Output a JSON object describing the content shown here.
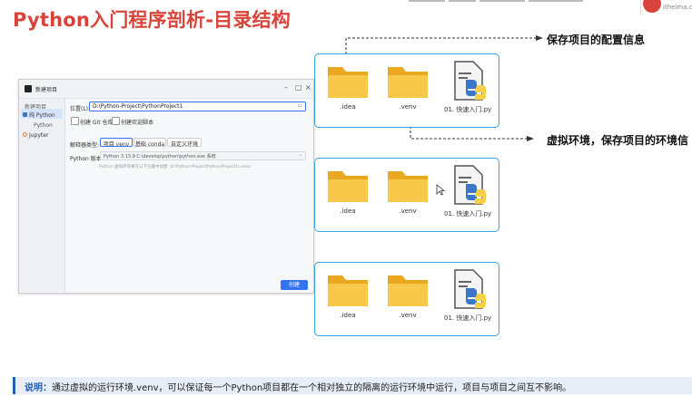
{
  "slide": {
    "title": "Python入门程序剖析-目录结构",
    "logo_text": "itheima.com",
    "note_label": "说明：",
    "note_text": "通过虚拟的运行环境.venv，可以保证每一个Python项目都在一个相对独立的隔离的运行环境中运行，项目与项目之间互不影响。"
  },
  "dialog": {
    "title": "新建项目",
    "sidebar": {
      "header": "新建项目",
      "items": [
        "纯 Python",
        "Python",
        "Jupyter"
      ],
      "selected_index": 0
    },
    "location_label": "位置(L):",
    "location_value": "D:\\Python-Project\\PythonProject1",
    "git_checkbox": "创建 Git 仓库",
    "welcome_checkbox": "创建欢迎脚本",
    "interpreter_label": "解释器类型:",
    "interpreter_options": [
      "项目 venv",
      "基础 conda",
      "自定义环境"
    ],
    "interpreter_selected": 0,
    "python_version_label": "Python 版本:",
    "python_version_value": "Python 3.13.9  C:\\develop\\python\\python.exe  系统",
    "hint": "Python 虚拟环境将在以下位置中创建: D:\\Python-Project\\PythonProject1\\.venv",
    "create_button": "创建"
  },
  "panels": [
    {
      "files": [
        ".idea",
        ".venv",
        "01. 快速入门.py"
      ]
    },
    {
      "files": [
        ".idea",
        ".venv",
        "01. 快速入门.py"
      ]
    },
    {
      "files": [
        ".idea",
        ".venv",
        "01. 快速入门.py"
      ]
    }
  ],
  "annotations": {
    "config": "保存项目的配置信息",
    "venv": "虚拟环境，保存项目的环境信"
  },
  "colors": {
    "title_red": "#d9443a",
    "panel_border": "#3aa3dc",
    "folder_yellow": "#f5b92e",
    "accent_blue": "#3574f0"
  }
}
